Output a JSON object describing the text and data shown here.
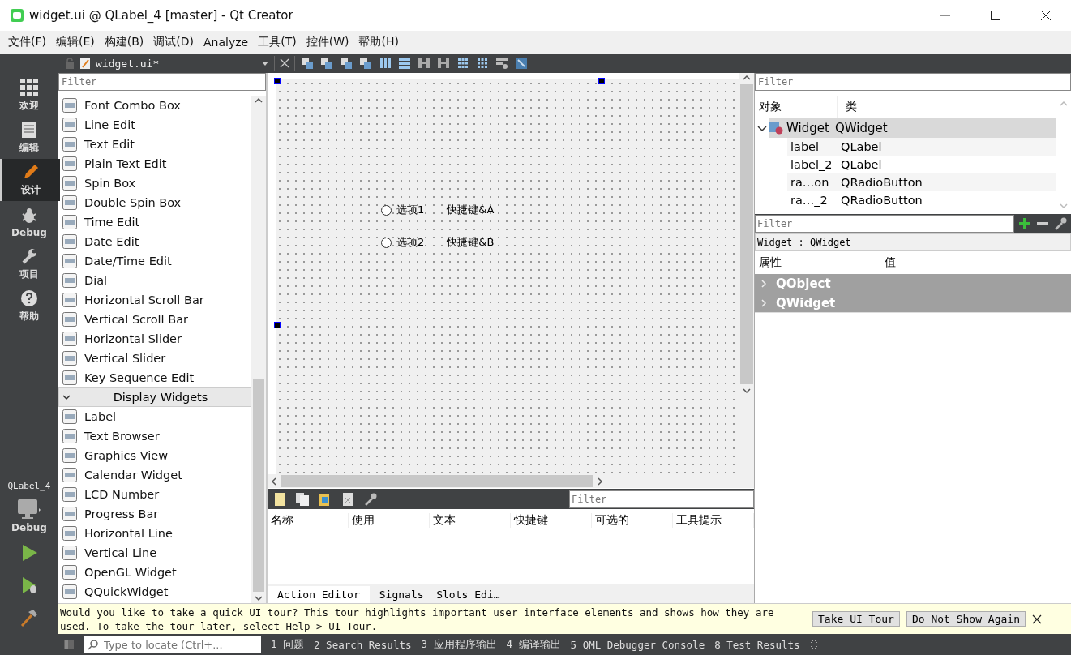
{
  "window": {
    "title": "widget.ui @ QLabel_4 [master] - Qt Creator"
  },
  "menu": [
    "文件(F)",
    "编辑(E)",
    "构建(B)",
    "调试(D)",
    "Analyze",
    "工具(T)",
    "控件(W)",
    "帮助(H)"
  ],
  "modes": [
    {
      "label": "欢迎",
      "kind": "welcome",
      "selected": false
    },
    {
      "label": "编辑",
      "kind": "edit",
      "selected": false
    },
    {
      "label": "设计",
      "kind": "design",
      "selected": true
    },
    {
      "label": "Debug",
      "kind": "debug",
      "selected": false
    },
    {
      "label": "项目",
      "kind": "projects",
      "selected": false
    },
    {
      "label": "帮助",
      "kind": "help",
      "selected": false
    }
  ],
  "kit": {
    "project": "QLabel_4",
    "build": "Debug"
  },
  "editor_toolbar": {
    "file": "widget.ui*"
  },
  "widget_box": {
    "placeholder": "Filter",
    "items": [
      {
        "kind": "widget",
        "label": "Font Combo Box"
      },
      {
        "kind": "widget",
        "label": "Line Edit"
      },
      {
        "kind": "widget",
        "label": "Text Edit"
      },
      {
        "kind": "widget",
        "label": "Plain Text Edit"
      },
      {
        "kind": "widget",
        "label": "Spin Box"
      },
      {
        "kind": "widget",
        "label": "Double Spin Box"
      },
      {
        "kind": "widget",
        "label": "Time Edit"
      },
      {
        "kind": "widget",
        "label": "Date Edit"
      },
      {
        "kind": "widget",
        "label": "Date/Time Edit"
      },
      {
        "kind": "widget",
        "label": "Dial"
      },
      {
        "kind": "widget",
        "label": "Horizontal Scroll Bar"
      },
      {
        "kind": "widget",
        "label": "Vertical Scroll Bar"
      },
      {
        "kind": "widget",
        "label": "Horizontal Slider"
      },
      {
        "kind": "widget",
        "label": "Vertical Slider"
      },
      {
        "kind": "widget",
        "label": "Key Sequence Edit"
      },
      {
        "kind": "category",
        "label": "Display Widgets",
        "expanded": true
      },
      {
        "kind": "widget",
        "label": "Label"
      },
      {
        "kind": "widget",
        "label": "Text Browser"
      },
      {
        "kind": "widget",
        "label": "Graphics View"
      },
      {
        "kind": "widget",
        "label": "Calendar Widget"
      },
      {
        "kind": "widget",
        "label": "LCD Number"
      },
      {
        "kind": "widget",
        "label": "Progress Bar"
      },
      {
        "kind": "widget",
        "label": "Horizontal Line"
      },
      {
        "kind": "widget",
        "label": "Vertical Line"
      },
      {
        "kind": "widget",
        "label": "OpenGL Widget"
      },
      {
        "kind": "widget",
        "label": "QQuickWidget"
      }
    ]
  },
  "form": {
    "rows": [
      {
        "radio": "选项1",
        "checked": false,
        "label": "快捷键&A"
      },
      {
        "radio": "选项2",
        "checked": false,
        "label": "快捷键&B"
      }
    ]
  },
  "action_editor": {
    "placeholder": "Filter",
    "columns": [
      "名称",
      "使用",
      "文本",
      "快捷键",
      "可选的",
      "工具提示"
    ],
    "tabs": [
      {
        "label": "Action Editor",
        "selected": true
      },
      {
        "label": "Signals  Slots Edi…",
        "selected": false
      }
    ]
  },
  "object_inspector": {
    "placeholder": "Filter",
    "columns": [
      "对象",
      "类"
    ],
    "tree": [
      {
        "object": "Widget",
        "class": "QWidget",
        "expanded": true,
        "selected": true,
        "children": [
          {
            "object": "label",
            "class": "QLabel",
            "selected": false
          },
          {
            "object": "label_2",
            "class": "QLabel",
            "selected": false
          },
          {
            "object": "ra…on",
            "class": "QRadioButton",
            "selected": false
          },
          {
            "object": "ra…_2",
            "class": "QRadioButton",
            "selected": false
          }
        ]
      }
    ]
  },
  "property_editor": {
    "placeholder": "Filter",
    "object": "Widget : QWidget",
    "columns": [
      "属性",
      "值"
    ],
    "groups": [
      {
        "label": "QObject",
        "expanded": false
      },
      {
        "label": "QWidget",
        "expanded": false
      }
    ]
  },
  "tour": {
    "message": "Would you like to take a quick UI tour? This tour highlights important user interface elements and shows how they are used. To take the tour later, select Help > UI Tour.",
    "buttons": [
      "Take UI Tour",
      "Do Not Show Again"
    ]
  },
  "status_bar": {
    "placeholder": "Type to locate (Ctrl+...",
    "panes": [
      "1 问题",
      "2 Search Results",
      "3 应用程序输出",
      "4 编译输出",
      "5 QML Debugger Console",
      "8 Test Results"
    ]
  }
}
